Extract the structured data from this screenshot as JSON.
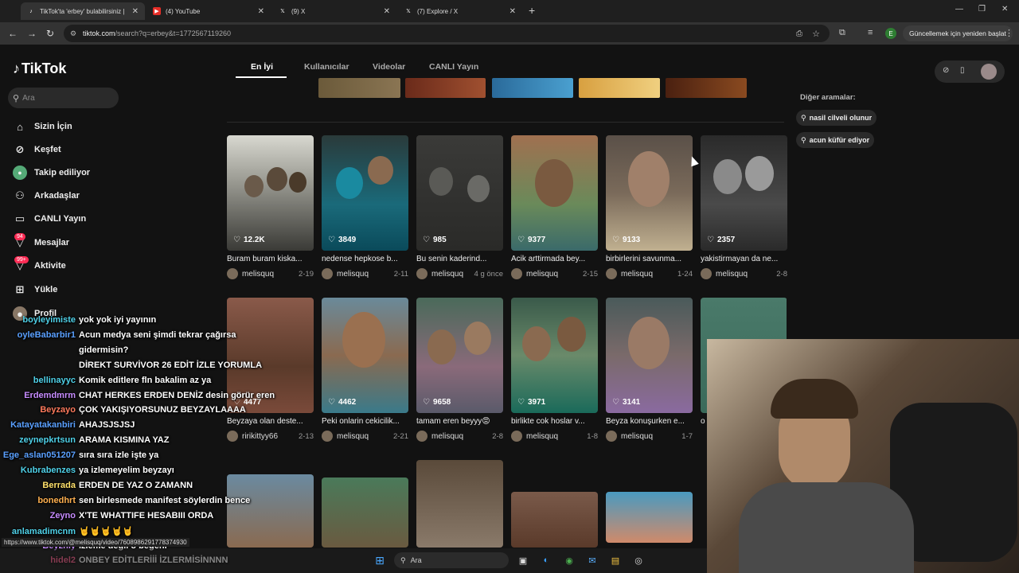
{
  "browser": {
    "tabs": [
      {
        "title": "TikTok'ta 'erbey' bulabilirsiniz |",
        "icon": "tiktok-icon"
      },
      {
        "title": "(4) YouTube",
        "icon": "youtube-icon"
      },
      {
        "title": "(9) X",
        "icon": "x-icon"
      },
      {
        "title": "(7) Explore / X",
        "icon": "x-icon"
      }
    ],
    "url_host": "tiktok.com",
    "url_path": "/search?q=erbey&t=1772567119260",
    "profile_initial": "E",
    "update_button": "Güncellemek için yeniden başlat"
  },
  "sidebar": {
    "logo": "TikTok",
    "search_placeholder": "Ara",
    "items": [
      {
        "label": "Sizin İçin",
        "icon": "home-icon"
      },
      {
        "label": "Keşfet",
        "icon": "compass-icon"
      },
      {
        "label": "Takip ediliyor",
        "icon": "following-avatar-icon"
      },
      {
        "label": "Arkadaşlar",
        "icon": "friends-icon"
      },
      {
        "label": "CANLI Yayın",
        "icon": "live-icon"
      },
      {
        "label": "Mesajlar",
        "icon": "messages-icon",
        "badge": "94"
      },
      {
        "label": "Aktivite",
        "icon": "activity-icon",
        "badge": "99+"
      },
      {
        "label": "Yükle",
        "icon": "upload-icon"
      },
      {
        "label": "Profil",
        "icon": "profile-icon"
      }
    ]
  },
  "search_tabs": [
    "En İyi",
    "Kullanıcılar",
    "Videolar",
    "CANLI Yayın"
  ],
  "other_searches": {
    "label": "Diğer aramalar:",
    "items": [
      "nasil cilveli olunur",
      "acun küfür ediyor"
    ]
  },
  "videos": [
    {
      "likes": "12.2K",
      "title": "Buram buram kiska...",
      "user": "melisquq",
      "date": "2-19"
    },
    {
      "likes": "3849",
      "title": "nedense hepkose b...",
      "user": "melisquq",
      "date": "2-11"
    },
    {
      "likes": "985",
      "title": "Bu senin kaderind...",
      "user": "melisquq",
      "date": "4 g önce"
    },
    {
      "likes": "9377",
      "title": "Acik arttirmada bey...",
      "user": "melisquq",
      "date": "2-15"
    },
    {
      "likes": "9133",
      "title": "birbirlerini savunma...",
      "user": "melisquq",
      "date": "1-24"
    },
    {
      "likes": "2357",
      "title": "yakistirmayan da ne...",
      "user": "melisquq",
      "date": "2-8"
    },
    {
      "likes": "4477",
      "title": "Beyzaya olan deste...",
      "user": "ririkittyy66",
      "date": "2-13"
    },
    {
      "likes": "4462",
      "title": "Peki onlarin cekicilik...",
      "user": "melisquq",
      "date": "2-21"
    },
    {
      "likes": "9658",
      "title": "tamam eren beyyy😡",
      "user": "melisquq",
      "date": "2-8"
    },
    {
      "likes": "3971",
      "title": "birlikte cok hoslar v...",
      "user": "melisquq",
      "date": "1-8"
    },
    {
      "likes": "3141",
      "title": "Beyza konuşurken e...",
      "user": "melisquq",
      "date": "1-7"
    },
    {
      "likes": "",
      "title": "o",
      "user": "",
      "date": ""
    }
  ],
  "chat": [
    {
      "user": "boyleyimiste",
      "color": "#4fd1e8",
      "msg": "yok yok iyi yayının"
    },
    {
      "user": "oyleBabarbir1",
      "color": "#5aa0ff",
      "msg": "Acun medya seni şimdi tekrar çağırsa"
    },
    {
      "user": "",
      "color": "#fff",
      "msg": "gidermisin?"
    },
    {
      "user": "",
      "color": "#fff",
      "msg": "DİREKT SURVİVOR 26 EDİT İZLE YORUMLA"
    },
    {
      "user": "bellinayyc",
      "color": "#4fd1e8",
      "msg": "Komik editlere fln bakalim az ya"
    },
    {
      "user": "Erdemdmrm",
      "color": "#c78cff",
      "msg": "CHAT HERKES ERDEN DENİZ desin görür eren"
    },
    {
      "user": "Beyzayo",
      "color": "#ff7a5c",
      "msg": "ÇOK YAKIŞIYORSUNUZ BEYZAYLAAAA"
    },
    {
      "user": "Katayatakanbiri",
      "color": "#5aa0ff",
      "msg": "AHAJSJSJSJ"
    },
    {
      "user": "zeynepkrtsun",
      "color": "#4fd1e8",
      "msg": "ARAMA KISMINA YAZ"
    },
    {
      "user": "Ege_aslan051207",
      "color": "#5aa0ff",
      "msg": "sıra sıra izle işte ya"
    },
    {
      "user": "Kubrabenzes",
      "color": "#4fd1e8",
      "msg": "ya izlemeyelim beyzayı"
    },
    {
      "user": "Berrada",
      "color": "#ffe16b",
      "msg": "ERDEN DE YAZ O ZAMANN"
    },
    {
      "user": "bonedhrt",
      "color": "#ffb04f",
      "msg": "sen birlesmede manifest söylerdin bence"
    },
    {
      "user": "Zeyno",
      "color": "#c78cff",
      "msg": "X'TE WHATTIFE HESABIII ORDA"
    },
    {
      "user": "anlamadimcnm",
      "color": "#4fd1e8",
      "msg": "🤘🤘🤘🤘🤘"
    },
    {
      "user": "Beyzniy",
      "color": "#c78cff",
      "msg": "izleme değil o begeni"
    },
    {
      "user": "hidel2",
      "color": "#ff5c8a",
      "msg": "ONBEY EDİTLERİİİ İZLERMİSİNNNN"
    }
  ],
  "taskbar": {
    "search_placeholder": "Ara"
  },
  "status_url": "https://www.tiktok.com/@melisquq/video/7608986291778374930"
}
